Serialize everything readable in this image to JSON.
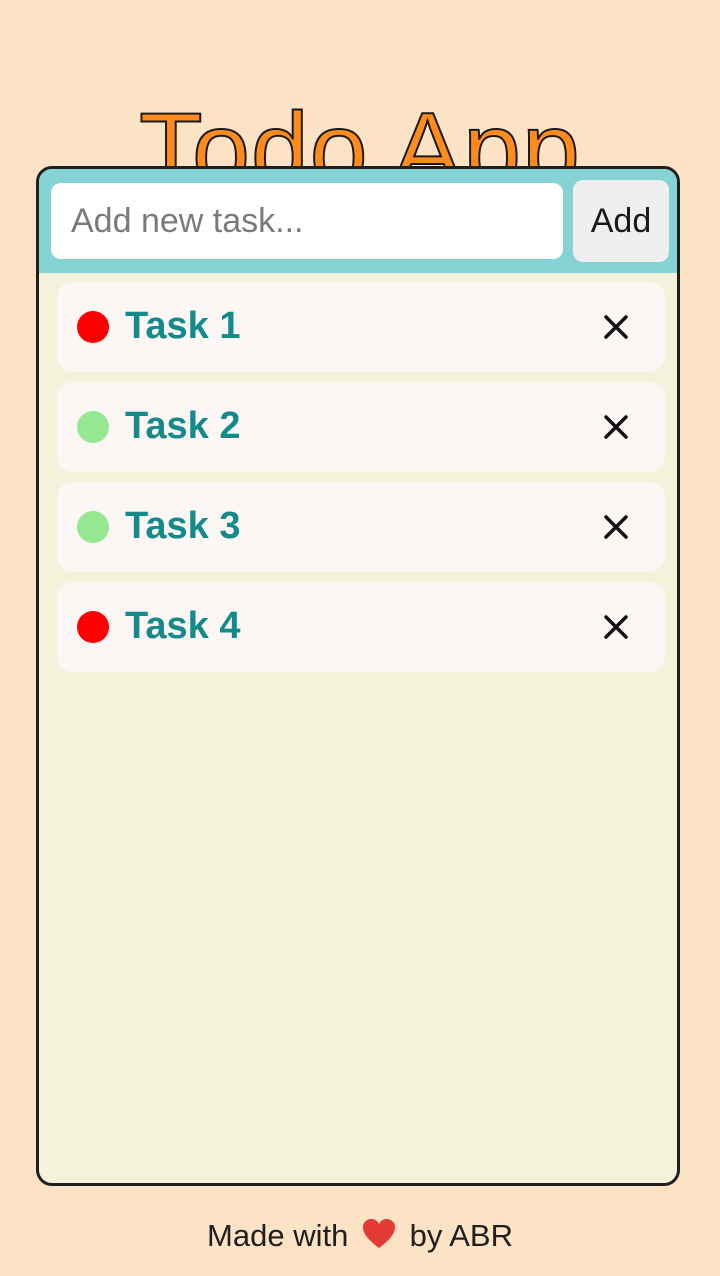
{
  "app": {
    "title": "Todo App"
  },
  "input": {
    "value": "",
    "placeholder": "Add new task...",
    "add_label": "Add"
  },
  "tasks": [
    {
      "label": "Task 1",
      "status_color": "#ff0000",
      "delete_icon": "close-icon"
    },
    {
      "label": "Task 2",
      "status_color": "#95e88f",
      "delete_icon": "close-icon"
    },
    {
      "label": "Task 3",
      "status_color": "#95e88f",
      "delete_icon": "close-icon"
    },
    {
      "label": "Task 4",
      "status_color": "#ff0000",
      "delete_icon": "close-icon"
    }
  ],
  "footer": {
    "prefix": "Made with",
    "icon": "heart-icon",
    "suffix": "by ABR"
  },
  "colors": {
    "background": "#fde3c5",
    "title": "#ff8c1a",
    "input_bar": "#86d3d6",
    "card": "#f5f2dc",
    "task_text": "#158a8a",
    "heart": "#e53935"
  }
}
